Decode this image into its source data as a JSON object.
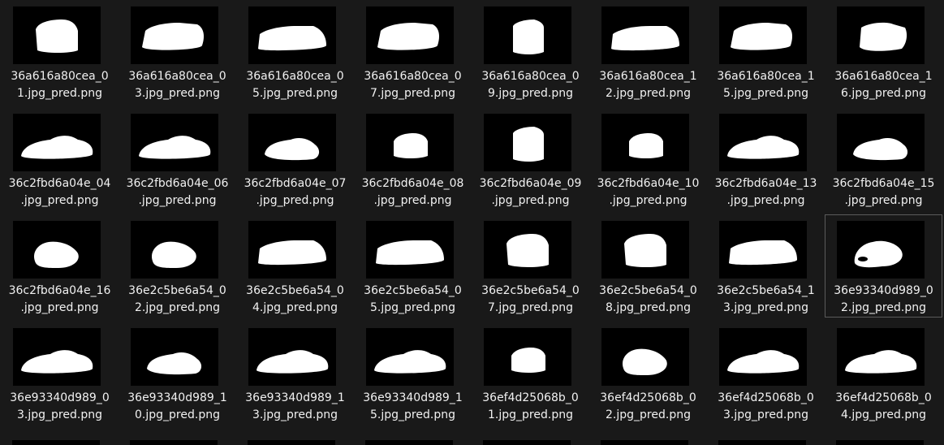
{
  "files": [
    {
      "line1": "36a616a80cea_0",
      "line2": "1.jpg_pred.png",
      "shape": "front"
    },
    {
      "line1": "36a616a80cea_0",
      "line2": "3.jpg_pred.png",
      "shape": "suv"
    },
    {
      "line1": "36a616a80cea_0",
      "line2": "5.jpg_pred.png",
      "shape": "suv-side"
    },
    {
      "line1": "36a616a80cea_0",
      "line2": "7.jpg_pred.png",
      "shape": "suv"
    },
    {
      "line1": "36a616a80cea_0",
      "line2": "9.jpg_pred.png",
      "shape": "rear"
    },
    {
      "line1": "36a616a80cea_1",
      "line2": "2.jpg_pred.png",
      "shape": "suv-side"
    },
    {
      "line1": "36a616a80cea_1",
      "line2": "5.jpg_pred.png",
      "shape": "suv"
    },
    {
      "line1": "36a616a80cea_1",
      "line2": "6.jpg_pred.png",
      "shape": "suv-small"
    },
    {
      "line1": "36c2fbd6a04e_04",
      "line2": ".jpg_pred.png",
      "shape": "sedan"
    },
    {
      "line1": "36c2fbd6a04e_06",
      "line2": ".jpg_pred.png",
      "shape": "sedan"
    },
    {
      "line1": "36c2fbd6a04e_07",
      "line2": ".jpg_pred.png",
      "shape": "sedan-small"
    },
    {
      "line1": "36c2fbd6a04e_08",
      "line2": ".jpg_pred.png",
      "shape": "front-small"
    },
    {
      "line1": "36c2fbd6a04e_09",
      "line2": ".jpg_pred.png",
      "shape": "rear"
    },
    {
      "line1": "36c2fbd6a04e_10",
      "line2": ".jpg_pred.png",
      "shape": "front-small"
    },
    {
      "line1": "36c2fbd6a04e_13",
      "line2": ".jpg_pred.png",
      "shape": "sedan"
    },
    {
      "line1": "36c2fbd6a04e_15",
      "line2": ".jpg_pred.png",
      "shape": "sedan-small"
    },
    {
      "line1": "36c2fbd6a04e_16",
      "line2": ".jpg_pred.png",
      "shape": "blob"
    },
    {
      "line1": "36e2c5be6a54_0",
      "line2": "2.jpg_pred.png",
      "shape": "blob"
    },
    {
      "line1": "36e2c5be6a54_0",
      "line2": "4.jpg_pred.png",
      "shape": "suv-side"
    },
    {
      "line1": "36e2c5be6a54_0",
      "line2": "5.jpg_pred.png",
      "shape": "suv-side"
    },
    {
      "line1": "36e2c5be6a54_0",
      "line2": "7.jpg_pred.png",
      "shape": "front"
    },
    {
      "line1": "36e2c5be6a54_0",
      "line2": "8.jpg_pred.png",
      "shape": "front"
    },
    {
      "line1": "36e2c5be6a54_1",
      "line2": "3.jpg_pred.png",
      "shape": "suv-side"
    },
    {
      "line1": "36e93340d989_0",
      "line2": "2.jpg_pred.png",
      "shape": "blob-hole"
    },
    {
      "line1": "36e93340d989_0",
      "line2": "3.jpg_pred.png",
      "shape": "sedan"
    },
    {
      "line1": "36e93340d989_1",
      "line2": "0.jpg_pred.png",
      "shape": "sedan-small"
    },
    {
      "line1": "36e93340d989_1",
      "line2": "3.jpg_pred.png",
      "shape": "sedan"
    },
    {
      "line1": "36e93340d989_1",
      "line2": "5.jpg_pred.png",
      "shape": "sedan"
    },
    {
      "line1": "36ef4d25068b_0",
      "line2": "1.jpg_pred.png",
      "shape": "front-small"
    },
    {
      "line1": "36ef4d25068b_0",
      "line2": "2.jpg_pred.png",
      "shape": "blob"
    },
    {
      "line1": "36ef4d25068b_0",
      "line2": "3.jpg_pred.png",
      "shape": "sedan"
    },
    {
      "line1": "36ef4d25068b_0",
      "line2": "4.jpg_pred.png",
      "shape": "sedan"
    }
  ],
  "selected_index": 23
}
